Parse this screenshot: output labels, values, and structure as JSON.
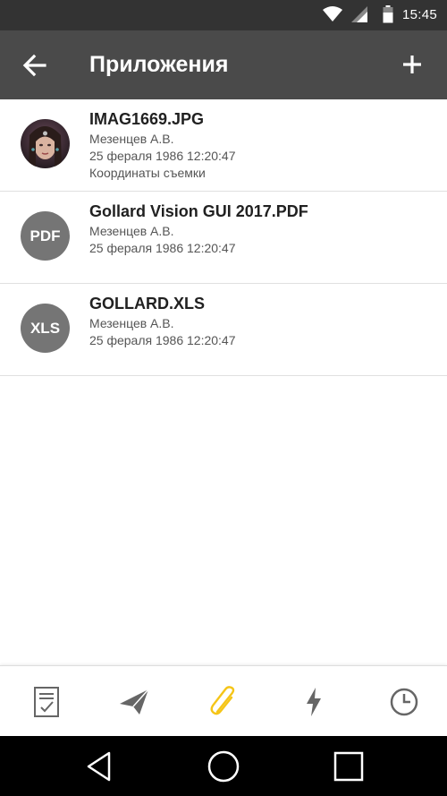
{
  "status_bar": {
    "time": "15:45",
    "icons": [
      "wifi-icon",
      "signal-icon",
      "battery-icon"
    ]
  },
  "app_bar": {
    "title": "Приложения",
    "back_icon": "arrow-left-icon",
    "add_icon": "plus-icon"
  },
  "files": [
    {
      "name": "IMAG1669.JPG",
      "author": "Мезенцев А.В.",
      "date": "25 фераля 1986  12:20:47",
      "extra": "Координаты съемки",
      "thumb": "photo-thumbnail"
    },
    {
      "name": "Gollard Vision GUI 2017.PDF",
      "author": "Мезенцев А.В.",
      "date": "25 фераля 1986  12:20:47",
      "badge": "PDF"
    },
    {
      "name": "GOLLARD.XLS",
      "author": "Мезенцев А.В.",
      "date": "25 фераля 1986  12:20:47",
      "badge": "XLS"
    }
  ],
  "bottom_nav": {
    "items": [
      "task-icon",
      "send-icon",
      "paperclip-icon",
      "lightning-icon",
      "clock-icon"
    ],
    "active_index": 2,
    "active_color": "#f5c518",
    "inactive_color": "#666666"
  },
  "system_nav": [
    "back-triangle-icon",
    "home-circle-icon",
    "recents-square-icon"
  ]
}
